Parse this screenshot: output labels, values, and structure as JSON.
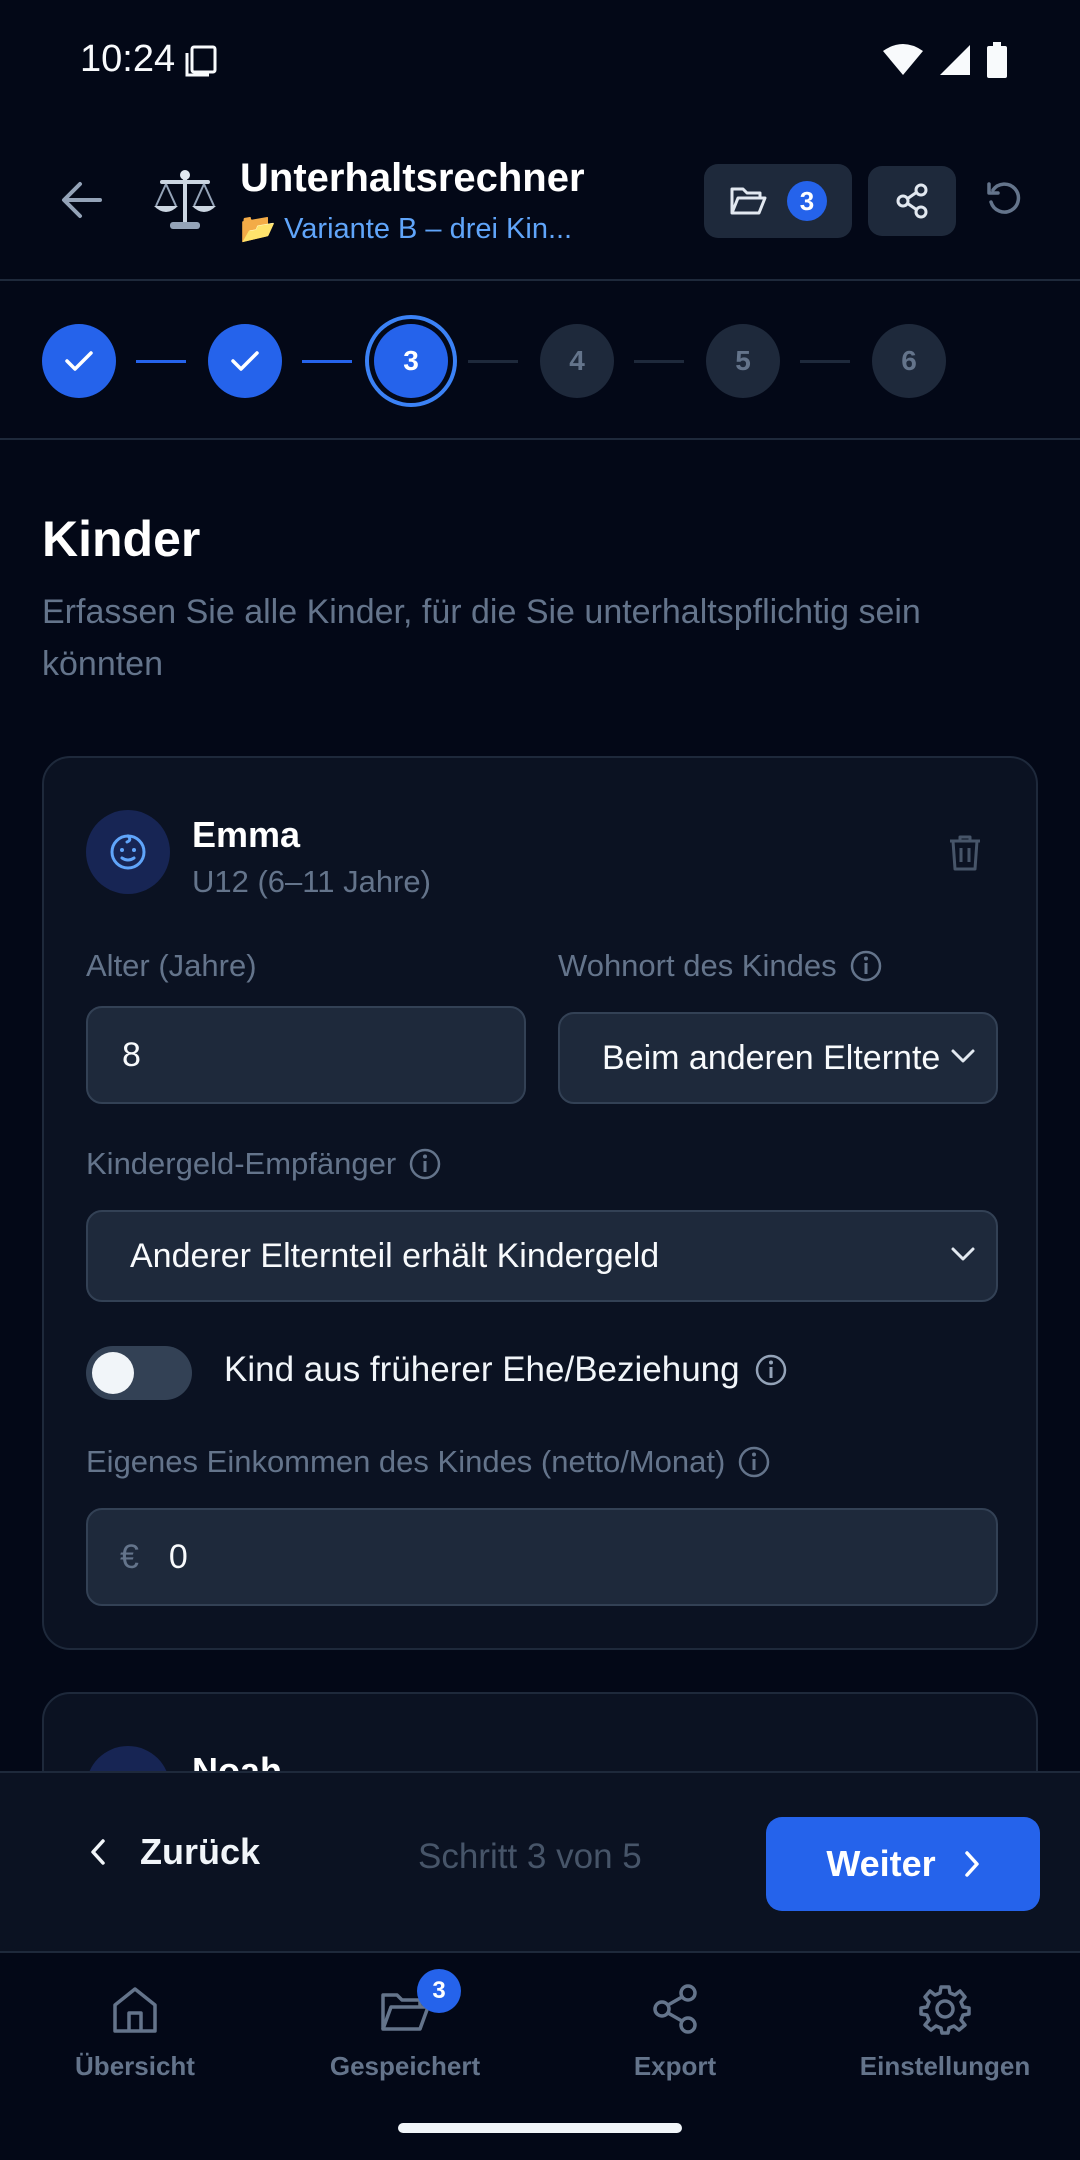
{
  "status_bar": {
    "time": "10:24"
  },
  "app_bar": {
    "title": "Unterhaltsrechner",
    "variant_emoji": "📂",
    "variant_name": "Variante B – drei Kin...",
    "saved_count": "3"
  },
  "stepper": {
    "steps": [
      {
        "label": "1",
        "state": "done"
      },
      {
        "label": "2",
        "state": "done"
      },
      {
        "label": "3",
        "state": "active"
      },
      {
        "label": "4",
        "state": "todo"
      },
      {
        "label": "5",
        "state": "todo"
      },
      {
        "label": "6",
        "state": "todo"
      }
    ]
  },
  "page": {
    "title": "Kinder",
    "description": "Erfassen Sie alle Kinder, für die Sie unterhaltspflichtig sein könnten"
  },
  "children": [
    {
      "name": "Emma",
      "age_group": "U12 (6–11 Jahre)",
      "age_label": "Alter (Jahre)",
      "age_value": "8",
      "residence_label": "Wohnort des Kindes",
      "residence_value": "Beim anderen Elternteil",
      "kindergeld_label": "Kindergeld-Empfänger",
      "kindergeld_value": "Anderer Elternteil erhält Kindergeld",
      "previous_relation_label": "Kind aus früherer Ehe/Beziehung",
      "previous_relation_on": false,
      "income_label": "Eigenes Einkommen des Kindes (netto/Monat)",
      "income_currency": "€",
      "income_value": "0"
    },
    {
      "name": "Noah"
    }
  ],
  "footer": {
    "back_label": "Zurück",
    "step_info": "Schritt 3 von 5",
    "next_label": "Weiter"
  },
  "tabbar": {
    "items": [
      {
        "label": "Übersicht",
        "icon": "home-icon"
      },
      {
        "label": "Gespeichert",
        "icon": "folder-open-icon",
        "badge": "3"
      },
      {
        "label": "Export",
        "icon": "share-icon"
      },
      {
        "label": "Einstellungen",
        "icon": "gear-icon"
      }
    ]
  },
  "colors": {
    "background": "#030817",
    "card": "#0b1222",
    "accent": "#2563eb",
    "muted_text": "#64748b",
    "link": "#60a5fa"
  }
}
